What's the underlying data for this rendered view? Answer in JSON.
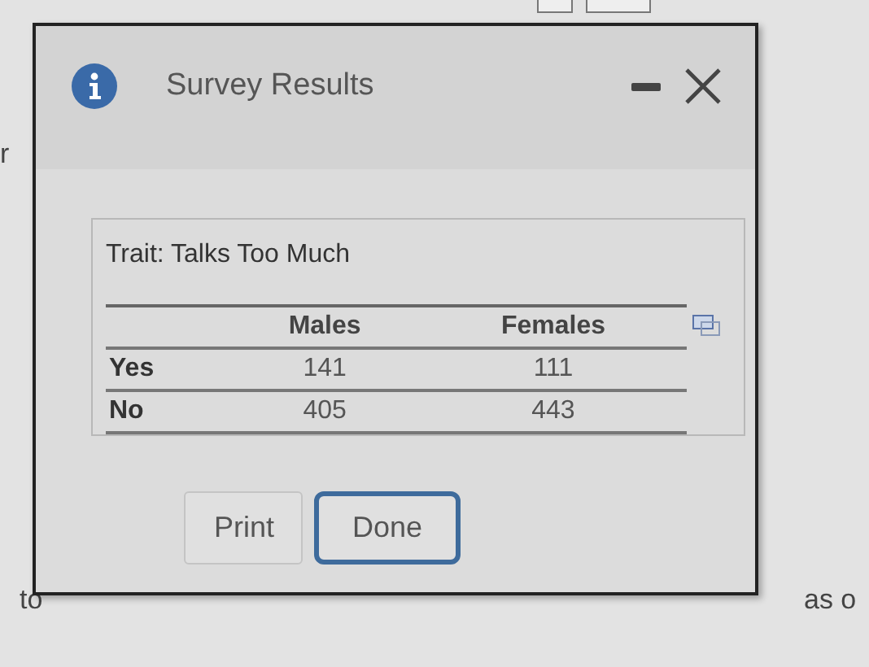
{
  "background": {
    "texts": [
      "r",
      "to",
      "as o"
    ]
  },
  "dialog": {
    "title": "Survey Results",
    "panel": {
      "heading": "Trait: Talks Too Much",
      "table": {
        "columns": [
          "",
          "Males",
          "Females"
        ],
        "rows": [
          [
            "Yes",
            "141",
            "111"
          ],
          [
            "No",
            "405",
            "443"
          ]
        ]
      }
    },
    "buttons": [
      {
        "label": "Print",
        "focused": false
      },
      {
        "label": "Done",
        "focused": true
      }
    ]
  }
}
